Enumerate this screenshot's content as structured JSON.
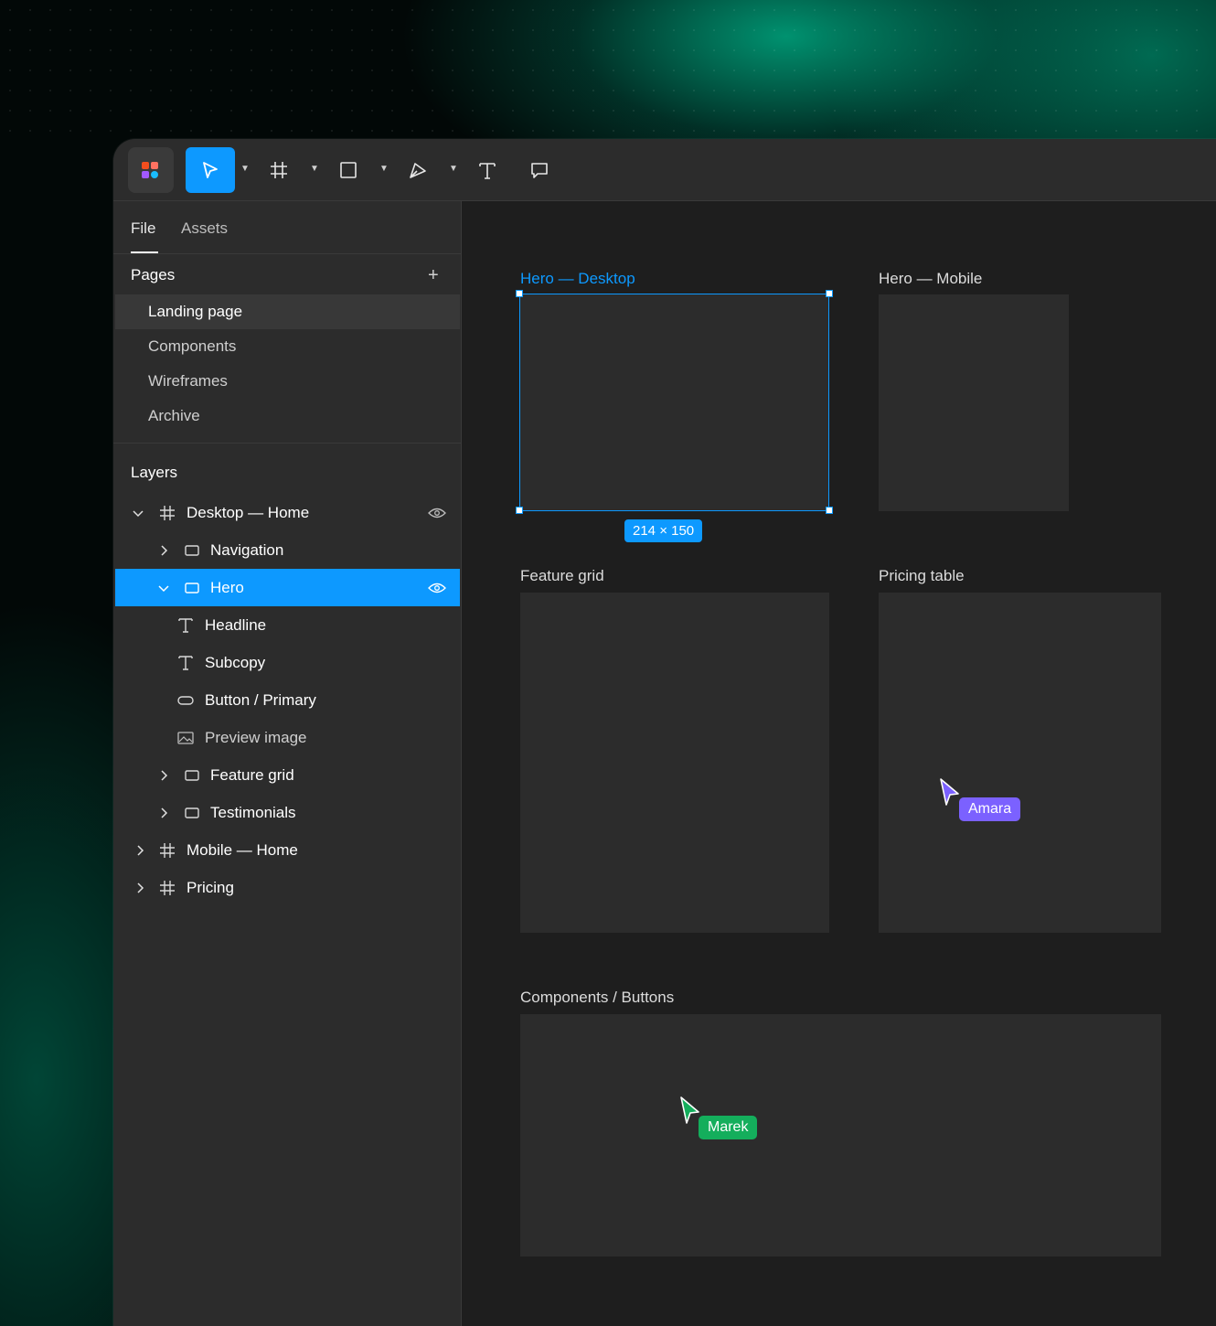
{
  "colors": {
    "accent": "#0d99ff",
    "panel": "#2c2c2c",
    "canvas": "#1e1e1e",
    "frame_fill": "#2c2c2c",
    "cursor_amara": "#7b61ff",
    "cursor_marek": "#14ae5c"
  },
  "toolbar": {
    "tools": [
      {
        "name": "move-tool",
        "icon": "cursor-arrow-icon",
        "active": true
      },
      {
        "name": "frame-tool",
        "icon": "hash-frame-icon",
        "active": false
      },
      {
        "name": "shape-tool",
        "icon": "rectangle-icon",
        "active": false
      },
      {
        "name": "pen-tool",
        "icon": "pen-icon",
        "active": false
      },
      {
        "name": "text-tool",
        "icon": "text-t-icon",
        "active": false
      },
      {
        "name": "comment-tool",
        "icon": "speech-bubble-icon",
        "active": false
      }
    ]
  },
  "sidebar": {
    "tabs": [
      {
        "label": "File",
        "active": true
      },
      {
        "label": "Assets",
        "active": false
      }
    ],
    "pages": {
      "title": "Pages",
      "add_icon": "plus-icon",
      "items": [
        {
          "label": "Landing page",
          "selected": true
        },
        {
          "label": "Components",
          "selected": false
        },
        {
          "label": "Wireframes",
          "selected": false
        },
        {
          "label": "Archive",
          "selected": false
        }
      ]
    },
    "layers": {
      "title": "Layers",
      "items": [
        {
          "label": "Desktop — Home",
          "icon": "frame-icon",
          "chevron": "expanded",
          "eye": true
        },
        {
          "label": "Navigation",
          "icon": "rectangle-icon",
          "chevron": "collapsed"
        },
        {
          "label": "Hero",
          "icon": "rectangle-icon",
          "chevron": "expanded",
          "eye": true,
          "selected": true
        },
        {
          "label": "Headline",
          "icon": "text-icon"
        },
        {
          "label": "Subcopy",
          "icon": "text-icon"
        },
        {
          "label": "Button / Primary",
          "icon": "pill-icon"
        },
        {
          "label": "Preview image",
          "icon": "image-icon"
        },
        {
          "label": "Feature grid",
          "icon": "rectangle-icon",
          "chevron": "collapsed"
        },
        {
          "label": "Testimonials",
          "icon": "rectangle-icon",
          "chevron": "collapsed"
        },
        {
          "label": "Mobile — Home",
          "icon": "frame-icon",
          "chevron": "collapsed"
        },
        {
          "label": "Pricing",
          "icon": "frame-icon",
          "chevron": "collapsed"
        }
      ]
    }
  },
  "canvas": {
    "frames": [
      {
        "label": "Hero — Desktop",
        "selected": true
      },
      {
        "label": "Hero — Mobile"
      },
      {
        "label": "Feature grid"
      },
      {
        "label": "Pricing table"
      },
      {
        "label": "Components / Buttons"
      }
    ],
    "selection_size": "214 × 150",
    "cursors": [
      {
        "name": "Amara"
      },
      {
        "name": "Marek"
      }
    ]
  }
}
